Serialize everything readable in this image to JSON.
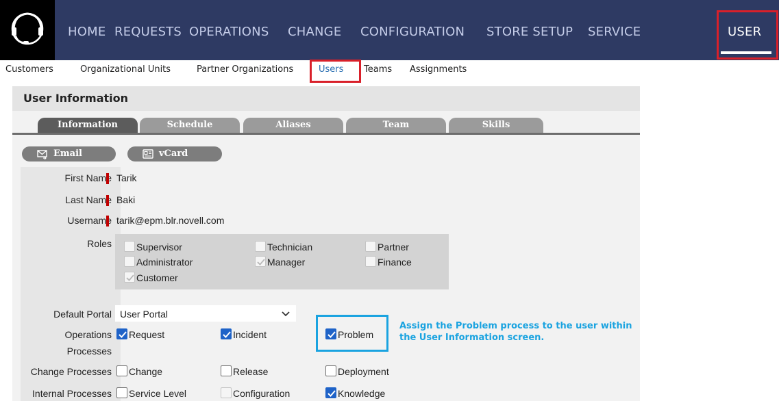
{
  "nav": {
    "items": [
      "HOME",
      "REQUESTS",
      "OPERATIONS",
      "CHANGE",
      "CONFIGURATION",
      "STORE SETUP",
      "SERVICE",
      "USER"
    ],
    "active": "USER"
  },
  "subnav": {
    "items": [
      "Customers",
      "Organizational Units",
      "Partner Organizations",
      "Users",
      "Teams",
      "Assignments"
    ],
    "active": "Users"
  },
  "panel": {
    "title": "User Information",
    "tabs": [
      "Information",
      "Schedule",
      "Aliases",
      "Team",
      "Skills"
    ],
    "active_tab": "Information",
    "actions": {
      "email": "Email",
      "vcard": "vCard"
    }
  },
  "form": {
    "first_name_label": "First Name",
    "first_name": "Tarik",
    "last_name_label": "Last Name",
    "last_name": "Baki",
    "username_label": "Username",
    "username": "tarik@epm.blr.novell.com",
    "roles_label": "Roles",
    "roles": {
      "supervisor": "Supervisor",
      "technician": "Technician",
      "partner": "Partner",
      "administrator": "Administrator",
      "manager": "Manager",
      "finance": "Finance",
      "customer": "Customer"
    },
    "default_portal_label": "Default Portal",
    "default_portal": "User Portal",
    "operations_label_1": "Operations",
    "operations_label_2": "Processes",
    "operations": {
      "request": "Request",
      "incident": "Incident",
      "problem": "Problem"
    },
    "change_label": "Change Processes",
    "change": {
      "change": "Change",
      "release": "Release",
      "deployment": "Deployment"
    },
    "internal_label": "Internal Processes",
    "internal": {
      "service_level": "Service Level",
      "configuration": "Configuration",
      "knowledge": "Knowledge"
    }
  },
  "callout": {
    "line1": "Assign the Problem process to the user within",
    "line2": "the User Information screen."
  },
  "colors": {
    "nav_bg": "#2e3a63",
    "red_highlight": "#d9202a",
    "blue_highlight": "#1aa3e0",
    "checkbox_checked": "#1f63c8"
  }
}
